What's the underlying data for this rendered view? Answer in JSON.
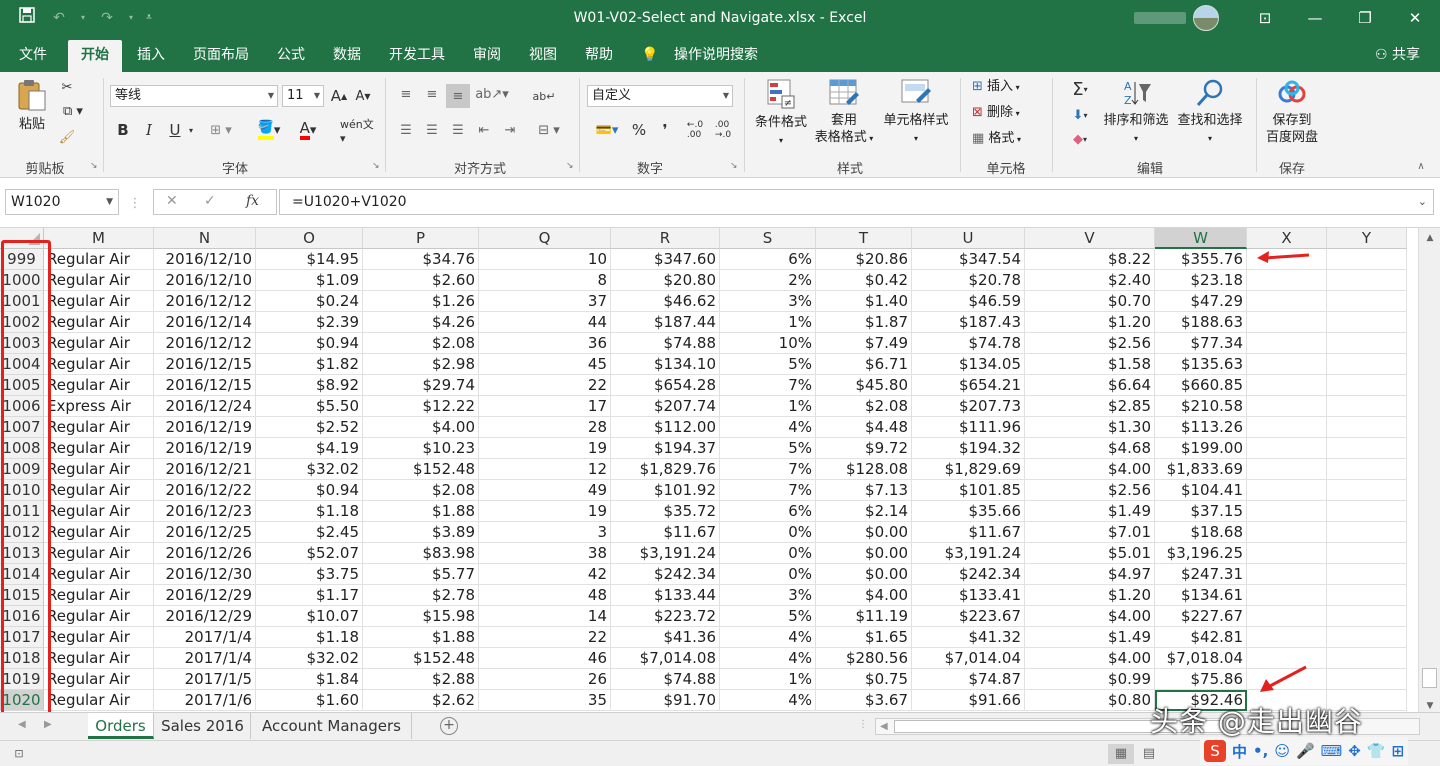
{
  "window": {
    "title": "W01-V02-Select and Navigate.xlsx  -  Excel"
  },
  "tabs": [
    {
      "label": "文件"
    },
    {
      "label": "开始"
    },
    {
      "label": "插入"
    },
    {
      "label": "页面布局"
    },
    {
      "label": "公式"
    },
    {
      "label": "数据"
    },
    {
      "label": "开发工具"
    },
    {
      "label": "审阅"
    },
    {
      "label": "视图"
    },
    {
      "label": "帮助"
    },
    {
      "label": "操作说明搜索"
    }
  ],
  "share_label": "共享",
  "ribbon": {
    "clipboard": {
      "paste": "粘贴",
      "group": "剪贴板"
    },
    "font": {
      "name": "等线",
      "size": "11",
      "group": "字体",
      "bold": "B",
      "italic": "I",
      "underline": "U"
    },
    "alignment": {
      "group": "对齐方式"
    },
    "number": {
      "format": "自定义",
      "group": "数字"
    },
    "styles": {
      "conditional": "条件格式",
      "table_line1": "套用",
      "table_line2": "表格格式",
      "cell_styles": "单元格样式",
      "group": "样式"
    },
    "cells": {
      "insert": "插入",
      "delete": "删除",
      "format": "格式",
      "group": "单元格"
    },
    "editing": {
      "sort": "排序和筛选",
      "find": "查找和选择",
      "group": "编辑"
    },
    "save": {
      "line1": "保存到",
      "line2": "百度网盘",
      "group": "保存"
    }
  },
  "formula_bar": {
    "name_box": "W1020",
    "formula": "=U1020+V1020"
  },
  "columns": [
    "M",
    "N",
    "O",
    "P",
    "Q",
    "R",
    "S",
    "T",
    "U",
    "V",
    "W",
    "X",
    "Y"
  ],
  "rows": [
    {
      "n": "999",
      "M": "Regular Air",
      "N": "2016/12/10",
      "O": "$14.95",
      "P": "$34.76",
      "Q": "10",
      "R": "$347.60",
      "S": "6%",
      "T": "$20.86",
      "U": "$347.54",
      "V": "$8.22",
      "W": "$355.76"
    },
    {
      "n": "1000",
      "M": "Regular Air",
      "N": "2016/12/10",
      "O": "$1.09",
      "P": "$2.60",
      "Q": "8",
      "R": "$20.80",
      "S": "2%",
      "T": "$0.42",
      "U": "$20.78",
      "V": "$2.40",
      "W": "$23.18"
    },
    {
      "n": "1001",
      "M": "Regular Air",
      "N": "2016/12/12",
      "O": "$0.24",
      "P": "$1.26",
      "Q": "37",
      "R": "$46.62",
      "S": "3%",
      "T": "$1.40",
      "U": "$46.59",
      "V": "$0.70",
      "W": "$47.29"
    },
    {
      "n": "1002",
      "M": "Regular Air",
      "N": "2016/12/14",
      "O": "$2.39",
      "P": "$4.26",
      "Q": "44",
      "R": "$187.44",
      "S": "1%",
      "T": "$1.87",
      "U": "$187.43",
      "V": "$1.20",
      "W": "$188.63"
    },
    {
      "n": "1003",
      "M": "Regular Air",
      "N": "2016/12/12",
      "O": "$0.94",
      "P": "$2.08",
      "Q": "36",
      "R": "$74.88",
      "S": "10%",
      "T": "$7.49",
      "U": "$74.78",
      "V": "$2.56",
      "W": "$77.34"
    },
    {
      "n": "1004",
      "M": "Regular Air",
      "N": "2016/12/15",
      "O": "$1.82",
      "P": "$2.98",
      "Q": "45",
      "R": "$134.10",
      "S": "5%",
      "T": "$6.71",
      "U": "$134.05",
      "V": "$1.58",
      "W": "$135.63"
    },
    {
      "n": "1005",
      "M": "Regular Air",
      "N": "2016/12/15",
      "O": "$8.92",
      "P": "$29.74",
      "Q": "22",
      "R": "$654.28",
      "S": "7%",
      "T": "$45.80",
      "U": "$654.21",
      "V": "$6.64",
      "W": "$660.85"
    },
    {
      "n": "1006",
      "M": "Express Air",
      "N": "2016/12/24",
      "O": "$5.50",
      "P": "$12.22",
      "Q": "17",
      "R": "$207.74",
      "S": "1%",
      "T": "$2.08",
      "U": "$207.73",
      "V": "$2.85",
      "W": "$210.58"
    },
    {
      "n": "1007",
      "M": "Regular Air",
      "N": "2016/12/19",
      "O": "$2.52",
      "P": "$4.00",
      "Q": "28",
      "R": "$112.00",
      "S": "4%",
      "T": "$4.48",
      "U": "$111.96",
      "V": "$1.30",
      "W": "$113.26"
    },
    {
      "n": "1008",
      "M": "Regular Air",
      "N": "2016/12/19",
      "O": "$4.19",
      "P": "$10.23",
      "Q": "19",
      "R": "$194.37",
      "S": "5%",
      "T": "$9.72",
      "U": "$194.32",
      "V": "$4.68",
      "W": "$199.00"
    },
    {
      "n": "1009",
      "M": "Regular Air",
      "N": "2016/12/21",
      "O": "$32.02",
      "P": "$152.48",
      "Q": "12",
      "R": "$1,829.76",
      "S": "7%",
      "T": "$128.08",
      "U": "$1,829.69",
      "V": "$4.00",
      "W": "$1,833.69"
    },
    {
      "n": "1010",
      "M": "Regular Air",
      "N": "2016/12/22",
      "O": "$0.94",
      "P": "$2.08",
      "Q": "49",
      "R": "$101.92",
      "S": "7%",
      "T": "$7.13",
      "U": "$101.85",
      "V": "$2.56",
      "W": "$104.41"
    },
    {
      "n": "1011",
      "M": "Regular Air",
      "N": "2016/12/23",
      "O": "$1.18",
      "P": "$1.88",
      "Q": "19",
      "R": "$35.72",
      "S": "6%",
      "T": "$2.14",
      "U": "$35.66",
      "V": "$1.49",
      "W": "$37.15"
    },
    {
      "n": "1012",
      "M": "Regular Air",
      "N": "2016/12/25",
      "O": "$2.45",
      "P": "$3.89",
      "Q": "3",
      "R": "$11.67",
      "S": "0%",
      "T": "$0.00",
      "U": "$11.67",
      "V": "$7.01",
      "W": "$18.68"
    },
    {
      "n": "1013",
      "M": "Regular Air",
      "N": "2016/12/26",
      "O": "$52.07",
      "P": "$83.98",
      "Q": "38",
      "R": "$3,191.24",
      "S": "0%",
      "T": "$0.00",
      "U": "$3,191.24",
      "V": "$5.01",
      "W": "$3,196.25"
    },
    {
      "n": "1014",
      "M": "Regular Air",
      "N": "2016/12/30",
      "O": "$3.75",
      "P": "$5.77",
      "Q": "42",
      "R": "$242.34",
      "S": "0%",
      "T": "$0.00",
      "U": "$242.34",
      "V": "$4.97",
      "W": "$247.31"
    },
    {
      "n": "1015",
      "M": "Regular Air",
      "N": "2016/12/29",
      "O": "$1.17",
      "P": "$2.78",
      "Q": "48",
      "R": "$133.44",
      "S": "3%",
      "T": "$4.00",
      "U": "$133.41",
      "V": "$1.20",
      "W": "$134.61"
    },
    {
      "n": "1016",
      "M": "Regular Air",
      "N": "2016/12/29",
      "O": "$10.07",
      "P": "$15.98",
      "Q": "14",
      "R": "$223.72",
      "S": "5%",
      "T": "$11.19",
      "U": "$223.67",
      "V": "$4.00",
      "W": "$227.67"
    },
    {
      "n": "1017",
      "M": "Regular Air",
      "N": "2017/1/4",
      "O": "$1.18",
      "P": "$1.88",
      "Q": "22",
      "R": "$41.36",
      "S": "4%",
      "T": "$1.65",
      "U": "$41.32",
      "V": "$1.49",
      "W": "$42.81"
    },
    {
      "n": "1018",
      "M": "Regular Air",
      "N": "2017/1/4",
      "O": "$32.02",
      "P": "$152.48",
      "Q": "46",
      "R": "$7,014.08",
      "S": "4%",
      "T": "$280.56",
      "U": "$7,014.04",
      "V": "$4.00",
      "W": "$7,018.04"
    },
    {
      "n": "1019",
      "M": "Regular Air",
      "N": "2017/1/5",
      "O": "$1.84",
      "P": "$2.88",
      "Q": "26",
      "R": "$74.88",
      "S": "1%",
      "T": "$0.75",
      "U": "$74.87",
      "V": "$0.99",
      "W": "$75.86"
    },
    {
      "n": "1020",
      "M": "Regular Air",
      "N": "2017/1/6",
      "O": "$1.60",
      "P": "$2.62",
      "Q": "35",
      "R": "$91.70",
      "S": "4%",
      "T": "$3.67",
      "U": "$91.66",
      "V": "$0.80",
      "W": "$92.46"
    }
  ],
  "active_cell": {
    "row": "1020",
    "col": "W"
  },
  "sheets": [
    {
      "label": "Orders"
    },
    {
      "label": "Sales 2016"
    },
    {
      "label": "Account Managers"
    }
  ],
  "watermark": "头条 @走出幽谷",
  "ime": {
    "lang": "中"
  },
  "colors": {
    "accent": "#217346",
    "annotation": "#e3221f"
  }
}
